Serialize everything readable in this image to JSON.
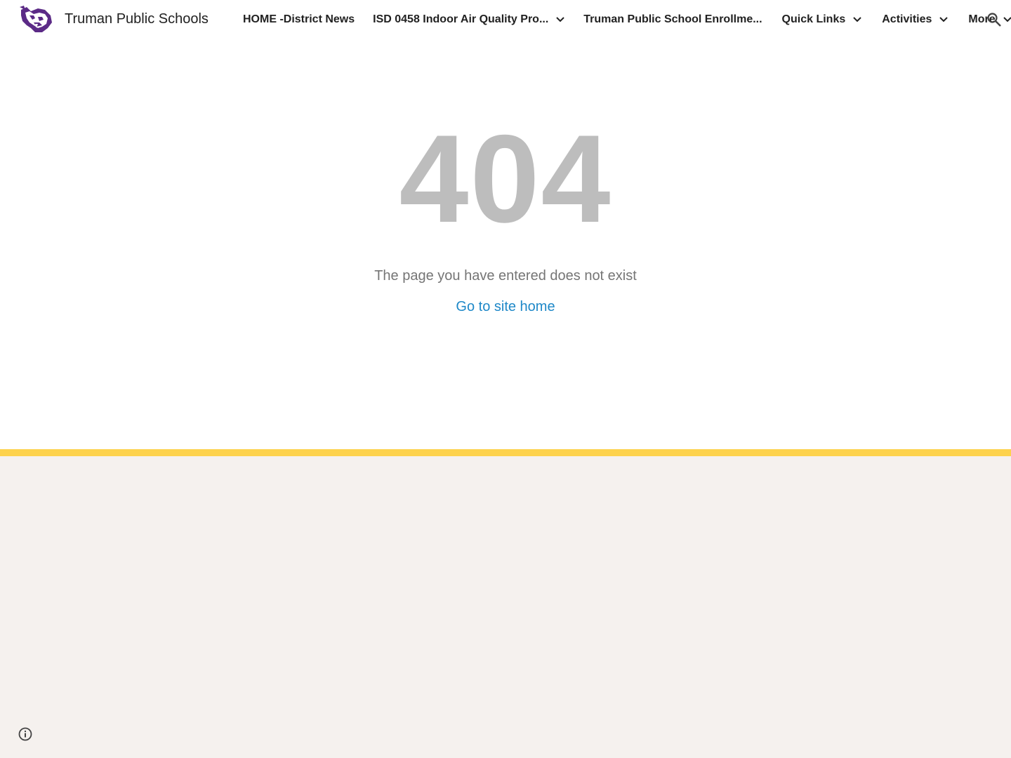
{
  "header": {
    "site_title": "Truman Public Schools",
    "logo_icon": "panther-logo-icon",
    "nav": [
      {
        "label": "HOME -District News",
        "has_dropdown": false
      },
      {
        "label": "ISD 0458 Indoor Air Quality Pro...",
        "has_dropdown": true
      },
      {
        "label": "Truman Public School Enrollme...",
        "has_dropdown": false
      },
      {
        "label": "Quick Links",
        "has_dropdown": true
      },
      {
        "label": "Activities",
        "has_dropdown": true
      },
      {
        "label": "More",
        "has_dropdown": true
      }
    ],
    "search_icon": "search-icon"
  },
  "main": {
    "error_code": "404",
    "message": "The page you have entered does not exist",
    "home_link": "Go to site home"
  },
  "footer": {
    "info_icon": "info-icon"
  },
  "colors": {
    "accent_link": "#1e88c8",
    "footer_bar": "#fdd24c",
    "footer_bg": "#f5f1ee",
    "error_code": "#bdbdbd",
    "brand_purple": "#5b2a86"
  }
}
